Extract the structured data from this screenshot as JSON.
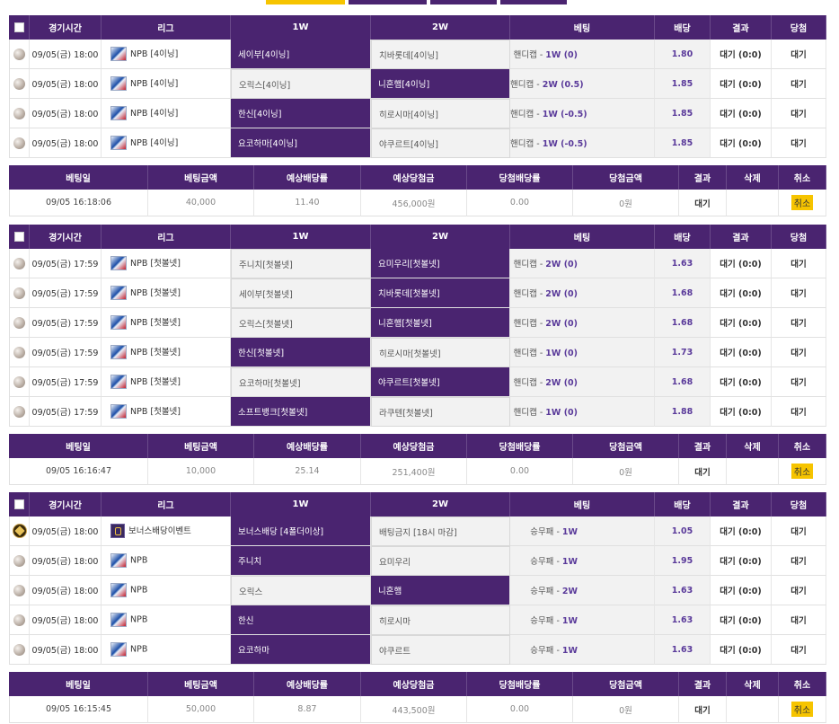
{
  "headers": {
    "time": "경기시간",
    "league": "리그",
    "w1": "1W",
    "w2": "2W",
    "bet": "베팅",
    "odds": "배당",
    "result": "결과",
    "win": "당첨"
  },
  "summary_headers": {
    "date": "베팅일",
    "amount": "베팅금액",
    "exp_odds": "예상배당률",
    "exp_win": "예상당첨금",
    "win_odds": "당첨배당률",
    "win_amount": "당첨금액",
    "result": "결과",
    "delete": "삭제",
    "cancel": "취소"
  },
  "groups": [
    {
      "rows": [
        {
          "icon": "baseball-icon",
          "time": "09/05(금) 18:00",
          "league": "NPB [4이닝]",
          "t1": "세이부[4이닝]",
          "t2": "치바롯데[4이닝]",
          "sel": 1,
          "bet_prefix": "핸디캡 -",
          "bet_val": "1W (0)",
          "odds": "1.80",
          "result": "대기 (0:0)",
          "win": "대기"
        },
        {
          "icon": "baseball-icon",
          "time": "09/05(금) 18:00",
          "league": "NPB [4이닝]",
          "t1": "오릭스[4이닝]",
          "t2": "니혼햄[4이닝]",
          "sel": 2,
          "bet_prefix": "핸디캡 -",
          "bet_val": "2W (0.5)",
          "odds": "1.85",
          "result": "대기 (0:0)",
          "win": "대기"
        },
        {
          "icon": "baseball-icon",
          "time": "09/05(금) 18:00",
          "league": "NPB [4이닝]",
          "t1": "한신[4이닝]",
          "t2": "히로시마[4이닝]",
          "sel": 1,
          "bet_prefix": "핸디캡 -",
          "bet_val": "1W (-0.5)",
          "odds": "1.85",
          "result": "대기 (0:0)",
          "win": "대기"
        },
        {
          "icon": "baseball-icon",
          "time": "09/05(금) 18:00",
          "league": "NPB [4이닝]",
          "t1": "요코하마[4이닝]",
          "t2": "야쿠르트[4이닝]",
          "sel": 1,
          "bet_prefix": "핸디캡 -",
          "bet_val": "1W (-0.5)",
          "odds": "1.85",
          "result": "대기 (0:0)",
          "win": "대기"
        }
      ],
      "summary": {
        "date": "09/05 16:18:06",
        "amount": "40,000",
        "exp_odds": "11.40",
        "exp_win": "456,000원",
        "win_odds": "0.00",
        "win_amount": "0원",
        "result": "대기",
        "cancel": "취소"
      }
    },
    {
      "rows": [
        {
          "icon": "baseball-icon",
          "time": "09/05(금) 17:59",
          "league": "NPB [첫볼넷]",
          "t1": "주니치[첫볼넷]",
          "t2": "요미우리[첫볼넷]",
          "sel": 2,
          "bet_prefix": "핸디캡 -",
          "bet_val": "2W (0)",
          "odds": "1.63",
          "result": "대기 (0:0)",
          "win": "대기"
        },
        {
          "icon": "baseball-icon",
          "time": "09/05(금) 17:59",
          "league": "NPB [첫볼넷]",
          "t1": "세이부[첫볼넷]",
          "t2": "치바롯데[첫볼넷]",
          "sel": 2,
          "bet_prefix": "핸디캡 -",
          "bet_val": "2W (0)",
          "odds": "1.68",
          "result": "대기 (0:0)",
          "win": "대기"
        },
        {
          "icon": "baseball-icon",
          "time": "09/05(금) 17:59",
          "league": "NPB [첫볼넷]",
          "t1": "오릭스[첫볼넷]",
          "t2": "니혼햄[첫볼넷]",
          "sel": 2,
          "bet_prefix": "핸디캡 -",
          "bet_val": "2W (0)",
          "odds": "1.68",
          "result": "대기 (0:0)",
          "win": "대기"
        },
        {
          "icon": "baseball-icon",
          "time": "09/05(금) 17:59",
          "league": "NPB [첫볼넷]",
          "t1": "한신[첫볼넷]",
          "t2": "히로시마[첫볼넷]",
          "sel": 1,
          "bet_prefix": "핸디캡 -",
          "bet_val": "1W (0)",
          "odds": "1.73",
          "result": "대기 (0:0)",
          "win": "대기"
        },
        {
          "icon": "baseball-icon",
          "time": "09/05(금) 17:59",
          "league": "NPB [첫볼넷]",
          "t1": "요코하마[첫볼넷]",
          "t2": "야쿠르트[첫볼넷]",
          "sel": 2,
          "bet_prefix": "핸디캡 -",
          "bet_val": "2W (0)",
          "odds": "1.68",
          "result": "대기 (0:0)",
          "win": "대기"
        },
        {
          "icon": "baseball-icon",
          "time": "09/05(금) 17:59",
          "league": "NPB [첫볼넷]",
          "t1": "소프트뱅크[첫볼넷]",
          "t2": "라쿠텐[첫볼넷]",
          "sel": 1,
          "bet_prefix": "핸디캡 -",
          "bet_val": "1W (0)",
          "odds": "1.88",
          "result": "대기 (0:0)",
          "win": "대기"
        }
      ],
      "summary": {
        "date": "09/05 16:16:47",
        "amount": "10,000",
        "exp_odds": "25.14",
        "exp_win": "251,400원",
        "win_odds": "0.00",
        "win_amount": "0원",
        "result": "대기",
        "cancel": "취소"
      }
    },
    {
      "rows": [
        {
          "icon": "bonus-event-icon",
          "time": "09/05(금) 18:00",
          "league": "보너스배당이벤트",
          "t1": "보너스배당 [4폴더이상]",
          "t2": "배팅금지 [18시 마감]",
          "sel": 1,
          "bet_prefix": "승무패 -",
          "bet_val": "1W",
          "odds": "1.05",
          "result": "대기 (0:0)",
          "win": "대기",
          "bonus": true
        },
        {
          "icon": "baseball-icon",
          "time": "09/05(금) 18:00",
          "league": "NPB",
          "t1": "주니치",
          "t2": "요미우리",
          "sel": 1,
          "bet_prefix": "승무패 -",
          "bet_val": "1W",
          "odds": "1.95",
          "result": "대기 (0:0)",
          "win": "대기"
        },
        {
          "icon": "baseball-icon",
          "time": "09/05(금) 18:00",
          "league": "NPB",
          "t1": "오릭스",
          "t2": "니혼햄",
          "sel": 2,
          "bet_prefix": "승무패 -",
          "bet_val": "2W",
          "odds": "1.63",
          "result": "대기 (0:0)",
          "win": "대기"
        },
        {
          "icon": "baseball-icon",
          "time": "09/05(금) 18:00",
          "league": "NPB",
          "t1": "한신",
          "t2": "히로시마",
          "sel": 1,
          "bet_prefix": "승무패 -",
          "bet_val": "1W",
          "odds": "1.63",
          "result": "대기 (0:0)",
          "win": "대기"
        },
        {
          "icon": "baseball-icon",
          "time": "09/05(금) 18:00",
          "league": "NPB",
          "t1": "요코하마",
          "t2": "야쿠르트",
          "sel": 1,
          "bet_prefix": "승무패 -",
          "bet_val": "1W",
          "odds": "1.63",
          "result": "대기 (0:0)",
          "win": "대기"
        }
      ],
      "summary": {
        "date": "09/05 16:15:45",
        "amount": "50,000",
        "exp_odds": "8.87",
        "exp_win": "443,500원",
        "win_odds": "0.00",
        "win_amount": "0원",
        "result": "대기",
        "cancel": "취소"
      }
    }
  ],
  "colors": {
    "header": "#4a2470",
    "selected": "#4a2470",
    "tab_active": "#f6c400",
    "cancel_badge": "#f6c400"
  }
}
